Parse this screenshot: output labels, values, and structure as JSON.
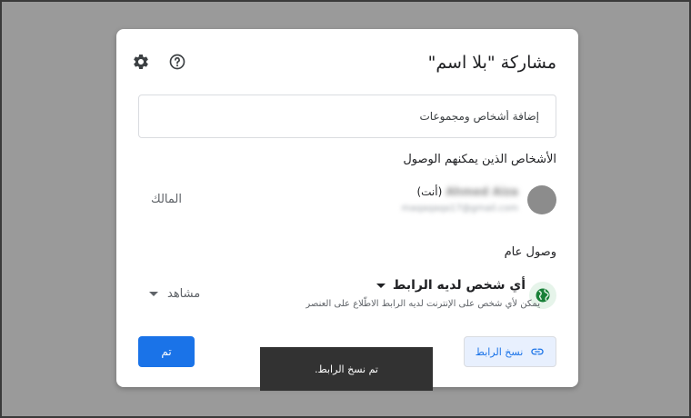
{
  "dialog": {
    "title": "مشاركة \"بلا اسم\"",
    "icons": {
      "settings": "gear-icon",
      "help": "help-icon"
    },
    "add_people_placeholder": "إضافة أشخاص ومجموعات",
    "access_section_title": "الأشخاص الذين يمكنهم الوصول",
    "person": {
      "name_redacted": "Ahmed Aiza",
      "you_label": "(أنت)",
      "email_redacted": "maqaqaqa17@gmail.com",
      "role": "المالك"
    },
    "general_access_title": "وصول عام",
    "general_access": {
      "selected": "أي شخص لديه الرابط",
      "description": "يمكن لأي شخص على الإنترنت لديه الرابط الاطّلاع على العنصر",
      "role": "مشاهد"
    },
    "copy_link_label": "نسخ الرابط",
    "done_label": "تم"
  },
  "toast": {
    "message": "تم نسخ الرابط."
  },
  "colors": {
    "accent": "#1a73e8",
    "globe_bg": "#e6f4ea",
    "globe": "#188038"
  }
}
